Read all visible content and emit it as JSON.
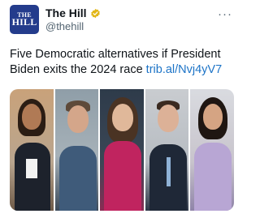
{
  "account": {
    "logo_line1": "THE",
    "logo_line2": "HILL",
    "display_name": "The Hill",
    "handle": "@thehill",
    "verified_color": "#e2b719"
  },
  "tweet": {
    "text": "Five Democratic alternatives if President Biden exits the 2024 race",
    "link": "trib.al/Nvj4yV7"
  },
  "colors": {
    "link": "#1d74c7",
    "logo_bg": "#243c8c"
  },
  "media": {
    "description_icon": "collage-of-five-portraits"
  }
}
